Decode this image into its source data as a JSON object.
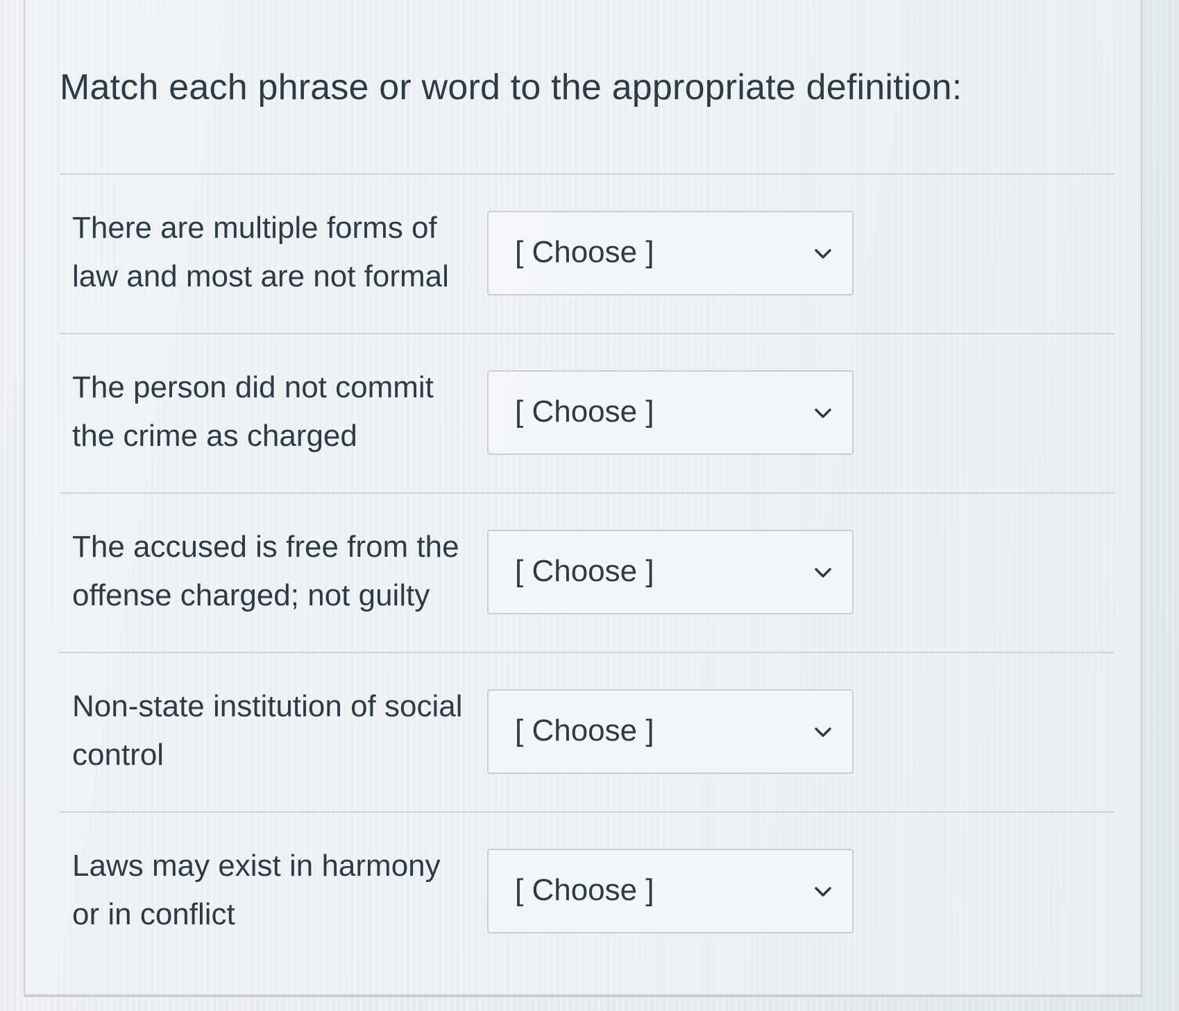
{
  "question": {
    "text": "Match each phrase or word to the appropriate definition:"
  },
  "answers": [
    {
      "prompt": "There are multiple forms of law and most are not formal",
      "selected": "[ Choose ]"
    },
    {
      "prompt": "The person did not commit the crime as charged",
      "selected": "[ Choose ]"
    },
    {
      "prompt": "The accused is free from the offense charged; not guilty",
      "selected": "[ Choose ]"
    },
    {
      "prompt": "Non-state institution of social control",
      "selected": "[ Choose ]"
    },
    {
      "prompt": "Laws may exist in harmony or in conflict",
      "selected": "[ Choose ]"
    }
  ],
  "icons": {
    "dropdown": "chevron-down-icon"
  },
  "colors": {
    "text": "#2d3b45",
    "border": "#c7cdd1",
    "background": "#e6ebee"
  }
}
